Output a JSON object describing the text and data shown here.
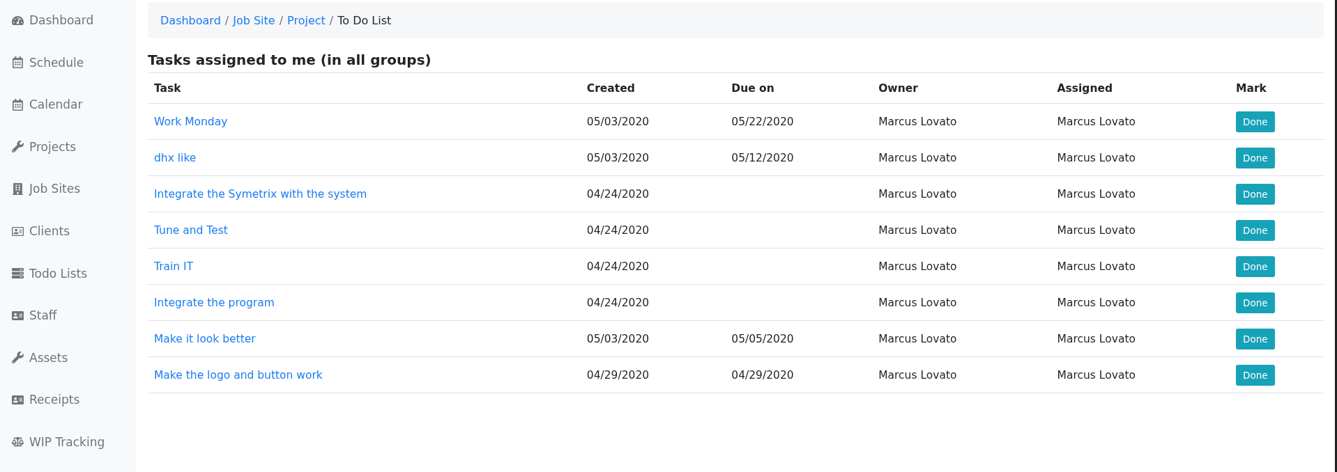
{
  "sidebar": {
    "items": [
      {
        "label": "Dashboard",
        "kind": "gauge"
      },
      {
        "label": "Schedule",
        "kind": "calendar"
      },
      {
        "label": "Calendar",
        "kind": "calendar"
      },
      {
        "label": "Projects",
        "kind": "wrench"
      },
      {
        "label": "Job Sites",
        "kind": "building"
      },
      {
        "label": "Clients",
        "kind": "card"
      },
      {
        "label": "Todo Lists",
        "kind": "server"
      },
      {
        "label": "Staff",
        "kind": "idcard"
      },
      {
        "label": "Assets",
        "kind": "wrench"
      },
      {
        "label": "Receipts",
        "kind": "idcard"
      },
      {
        "label": "WIP Tracking",
        "kind": "scale"
      }
    ]
  },
  "breadcrumb_separator": "/",
  "breadcrumb": [
    {
      "label": "Dashboard",
      "current": false
    },
    {
      "label": "Job Site",
      "current": false
    },
    {
      "label": "Project",
      "current": false
    },
    {
      "label": "To Do List",
      "current": true
    }
  ],
  "heading": "Tasks assigned to me (in all groups)",
  "table": {
    "columns": [
      "Task",
      "Created",
      "Due on",
      "Owner",
      "Assigned",
      "Mark"
    ],
    "rows": [
      {
        "task": "Work Monday",
        "created": "05/03/2020",
        "due": "05/22/2020",
        "owner": "Marcus Lovato",
        "assigned": "Marcus Lovato",
        "action": "Done"
      },
      {
        "task": "dhx like",
        "created": "05/03/2020",
        "due": "05/12/2020",
        "owner": "Marcus Lovato",
        "assigned": "Marcus Lovato",
        "action": "Done"
      },
      {
        "task": "Integrate the Symetrix with the system",
        "created": "04/24/2020",
        "owner": "Marcus Lovato",
        "assigned": "Marcus Lovato",
        "action": "Done"
      },
      {
        "task": "Tune and Test",
        "created": "04/24/2020",
        "owner": "Marcus Lovato",
        "assigned": "Marcus Lovato",
        "action": "Done"
      },
      {
        "task": "Train IT",
        "created": "04/24/2020",
        "owner": "Marcus Lovato",
        "assigned": "Marcus Lovato",
        "action": "Done"
      },
      {
        "task": "Integrate the program",
        "created": "04/24/2020",
        "owner": "Marcus Lovato",
        "assigned": "Marcus Lovato",
        "action": "Done"
      },
      {
        "task": "Make it look better",
        "created": "05/03/2020",
        "due": "05/05/2020",
        "owner": "Marcus Lovato",
        "assigned": "Marcus Lovato",
        "action": "Done"
      },
      {
        "task": "Make the logo and button work",
        "created": "04/29/2020",
        "due": "04/29/2020",
        "owner": "Marcus Lovato",
        "assigned": "Marcus Lovato",
        "action": "Done"
      }
    ]
  }
}
